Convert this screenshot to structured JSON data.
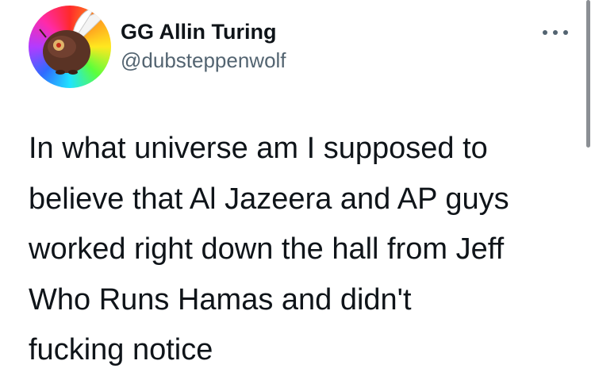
{
  "tweet": {
    "author": {
      "display_name": "GG Allin Turing",
      "handle": "@dubsteppenwolf",
      "avatar_icon": "winged-creature-avatar"
    },
    "more_icon": "more-horizontal-icon",
    "text_lines": [
      "In what universe am I supposed to",
      "believe that Al Jazeera and AP guys",
      "worked right down the hall from Jeff",
      "Who Runs Hamas and didn't",
      "fucking notice"
    ]
  },
  "colors": {
    "text_primary": "#0f1419",
    "text_secondary": "#536471",
    "background": "#ffffff"
  }
}
